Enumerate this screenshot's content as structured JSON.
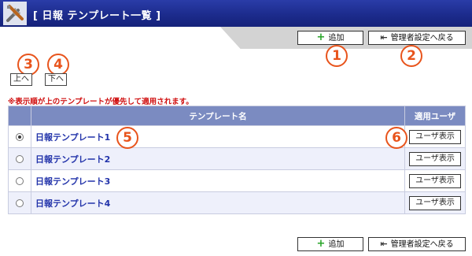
{
  "header": {
    "title": "[ 日報 テンプレート一覧 ]",
    "icon": "tools-icon"
  },
  "toolbar": {
    "add_label": "追加",
    "back_label": "管理者設定へ戻る"
  },
  "sort": {
    "up_label": "上へ",
    "down_label": "下へ"
  },
  "note": "※表示順が上のテンプレートが優先して適用されます。",
  "table": {
    "columns": [
      "テンプレート名",
      "適用ユーザ"
    ],
    "rows": [
      {
        "name": "日報テンプレート1",
        "selected": true,
        "button": "ユーザ表示"
      },
      {
        "name": "日報テンプレート2",
        "selected": false,
        "button": "ユーザ表示"
      },
      {
        "name": "日報テンプレート3",
        "selected": false,
        "button": "ユーザ表示"
      },
      {
        "name": "日報テンプレート4",
        "selected": false,
        "button": "ユーザ表示"
      }
    ]
  },
  "markers": [
    "1",
    "2",
    "3",
    "4",
    "5",
    "6"
  ],
  "colors": {
    "header": "#1b2a8a",
    "table_header": "#7b8bc1",
    "marker": "#e8541c",
    "note": "#d01010",
    "link": "#2233aa"
  }
}
